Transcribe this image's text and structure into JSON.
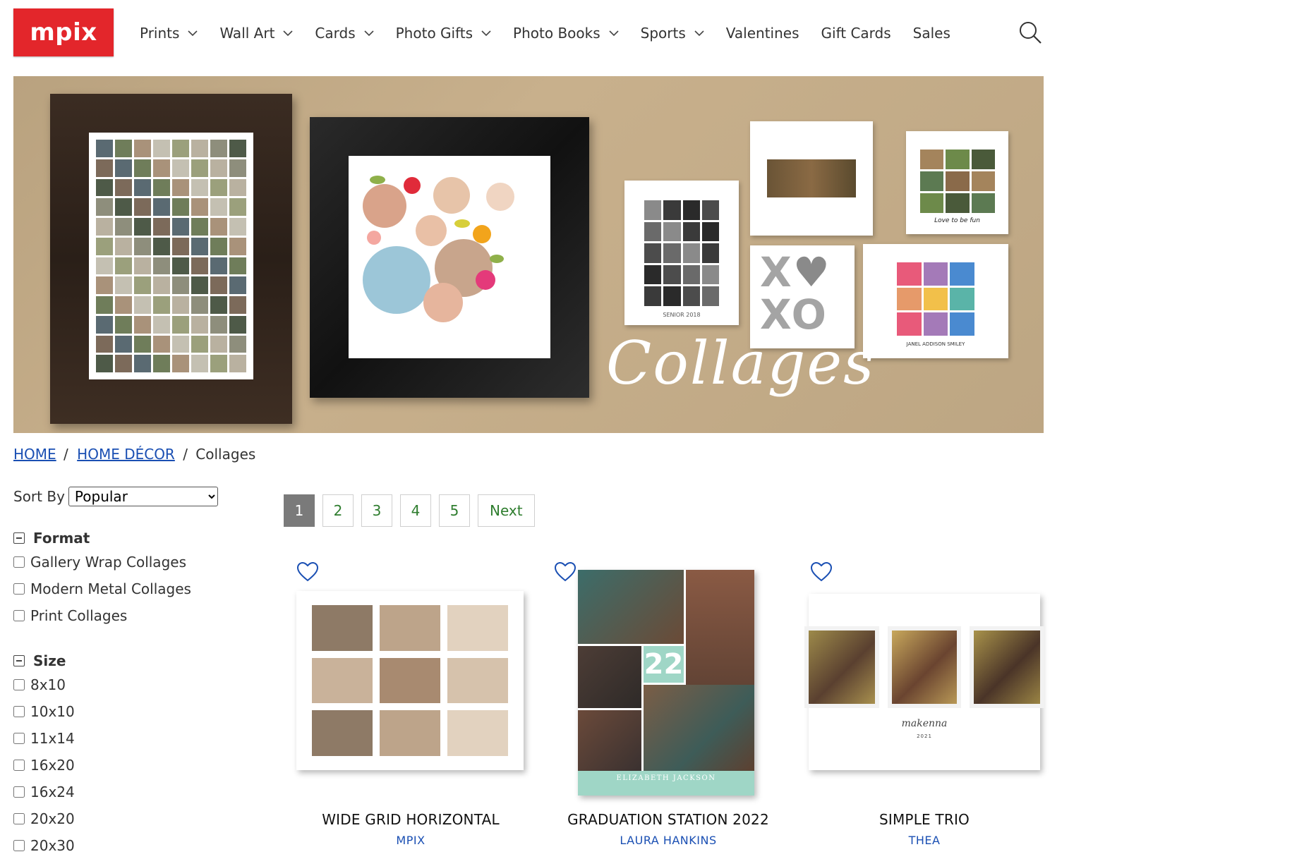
{
  "brand": {
    "logo_text": "mpix",
    "color": "#e3262b"
  },
  "nav": {
    "items": [
      {
        "label": "Prints",
        "dropdown": true
      },
      {
        "label": "Wall Art",
        "dropdown": true
      },
      {
        "label": "Cards",
        "dropdown": true
      },
      {
        "label": "Photo Gifts",
        "dropdown": true
      },
      {
        "label": "Photo Books",
        "dropdown": true
      },
      {
        "label": "Sports",
        "dropdown": true
      },
      {
        "label": "Valentines",
        "dropdown": false
      },
      {
        "label": "Gift Cards",
        "dropdown": false
      },
      {
        "label": "Sales",
        "dropdown": false
      }
    ],
    "search_icon": "search-icon"
  },
  "hero": {
    "title": "Collages",
    "card_captions": {
      "senior": "SENIOR 2018",
      "love": "Love to be fun",
      "name": "JANEL ADDISON SMILEY"
    }
  },
  "breadcrumb": {
    "home": "HOME",
    "decor": "HOME DÉCOR",
    "current": "Collages",
    "separator": "/"
  },
  "sort": {
    "label": "Sort By",
    "selected": "Popular"
  },
  "filters": {
    "format": {
      "title": "Format",
      "options": [
        "Gallery Wrap Collages",
        "Modern Metal Collages",
        "Print Collages"
      ]
    },
    "size": {
      "title": "Size",
      "options": [
        "8x10",
        "10x10",
        "11x14",
        "16x20",
        "16x24",
        "20x20",
        "20x30"
      ]
    }
  },
  "pagination": {
    "pages": [
      "1",
      "2",
      "3",
      "4",
      "5"
    ],
    "current": "1",
    "next": "Next"
  },
  "products": [
    {
      "title": "WIDE GRID HORIZONTAL",
      "brand": "MPIX"
    },
    {
      "title": "GRADUATION STATION 2022",
      "brand": "LAURA HANKINS",
      "card_name": "ELIZABETH JACKSON",
      "card_number": "22"
    },
    {
      "title": "SIMPLE TRIO",
      "brand": "THEA",
      "card_name": "makenna",
      "card_year": "2021"
    }
  ],
  "colors": {
    "link": "#1a4fb3",
    "pager_text": "#2e7d2e",
    "pager_active": "#7a7a7a",
    "grad_teal": "#9fd6c6"
  }
}
